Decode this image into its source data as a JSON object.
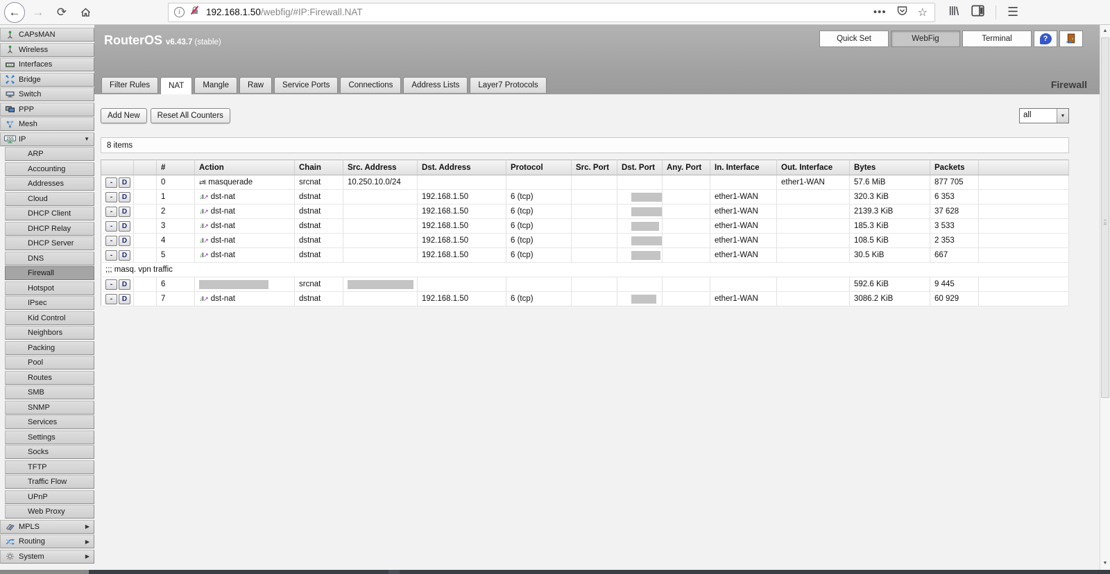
{
  "browser": {
    "url_host": "192.168.1.50",
    "url_path": "/webfig/#IP:Firewall.NAT"
  },
  "app_header": {
    "brand": "RouterOS",
    "version": "v6.43.7",
    "release": "(stable)",
    "nav_buttons": [
      {
        "label": "Quick Set",
        "active": false
      },
      {
        "label": "WebFig",
        "active": true
      },
      {
        "label": "Terminal",
        "active": false
      }
    ],
    "page_title": "Firewall"
  },
  "tabs": [
    {
      "label": "Filter Rules",
      "active": false
    },
    {
      "label": "NAT",
      "active": true
    },
    {
      "label": "Mangle",
      "active": false
    },
    {
      "label": "Raw",
      "active": false
    },
    {
      "label": "Service Ports",
      "active": false
    },
    {
      "label": "Connections",
      "active": false
    },
    {
      "label": "Address Lists",
      "active": false
    },
    {
      "label": "Layer7 Protocols",
      "active": false
    }
  ],
  "toolbar": {
    "add_new_label": "Add New",
    "reset_label": "Reset All Counters",
    "filter_value": "all"
  },
  "items_label": "8 items",
  "table": {
    "headers": [
      "#",
      "Action",
      "Chain",
      "Src. Address",
      "Dst. Address",
      "Protocol",
      "Src. Port",
      "Dst. Port",
      "Any. Port",
      "In. Interface",
      "Out. Interface",
      "Bytes",
      "Packets"
    ],
    "row_buttons": [
      "-",
      "D"
    ],
    "rows": [
      {
        "type": "rule",
        "num": "0",
        "action": "masquerade",
        "icon": "masquerade",
        "chain": "srcnat",
        "src_address": "10.250.10.0/24",
        "dst_address": "",
        "protocol": "",
        "src_port": "",
        "dst_port": "",
        "any_port": "",
        "in_interface": "",
        "out_interface": "ether1-WAN",
        "bytes": "57.6 MiB",
        "packets": "877 705",
        "redactions": {}
      },
      {
        "type": "rule",
        "num": "1",
        "action": "dst-nat",
        "icon": "dst-nat",
        "chain": "dstnat",
        "src_address": "",
        "dst_address": "192.168.1.50",
        "protocol": "6 (tcp)",
        "src_port": "",
        "dst_port": "",
        "any_port": "",
        "in_interface": "ether1-WAN",
        "out_interface": "",
        "bytes": "320.3 KiB",
        "packets": "6 353",
        "redactions": {
          "dst_port": 54
        }
      },
      {
        "type": "rule",
        "num": "2",
        "action": "dst-nat",
        "icon": "dst-nat",
        "chain": "dstnat",
        "src_address": "",
        "dst_address": "192.168.1.50",
        "protocol": "6 (tcp)",
        "src_port": "",
        "dst_port": "",
        "any_port": "",
        "in_interface": "ether1-WAN",
        "out_interface": "",
        "bytes": "2139.3 KiB",
        "packets": "37 628",
        "redactions": {
          "dst_port": 52
        }
      },
      {
        "type": "rule",
        "num": "3",
        "action": "dst-nat",
        "icon": "dst-nat",
        "chain": "dstnat",
        "src_address": "",
        "dst_address": "192.168.1.50",
        "protocol": "6 (tcp)",
        "src_port": "",
        "dst_port": "",
        "any_port": "",
        "in_interface": "ether1-WAN",
        "out_interface": "",
        "bytes": "185.3 KiB",
        "packets": "3 533",
        "redactions": {
          "dst_port": 40
        }
      },
      {
        "type": "rule",
        "num": "4",
        "action": "dst-nat",
        "icon": "dst-nat",
        "chain": "dstnat",
        "src_address": "",
        "dst_address": "192.168.1.50",
        "protocol": "6 (tcp)",
        "src_port": "",
        "dst_port": "",
        "any_port": "",
        "in_interface": "ether1-WAN",
        "out_interface": "",
        "bytes": "108.5 KiB",
        "packets": "2 353",
        "redactions": {
          "dst_port": 45
        }
      },
      {
        "type": "rule",
        "num": "5",
        "action": "dst-nat",
        "icon": "dst-nat",
        "chain": "dstnat",
        "src_address": "",
        "dst_address": "192.168.1.50",
        "protocol": "6 (tcp)",
        "src_port": "",
        "dst_port": "",
        "any_port": "",
        "in_interface": "ether1-WAN",
        "out_interface": "",
        "bytes": "30.5 KiB",
        "packets": "667",
        "redactions": {
          "dst_port": 42
        }
      },
      {
        "type": "comment",
        "text": ";;; masq. vpn traffic"
      },
      {
        "type": "rule",
        "num": "6",
        "action": "",
        "icon": null,
        "chain": "srcnat",
        "src_address": "",
        "dst_address": "",
        "protocol": "",
        "src_port": "",
        "dst_port": "",
        "any_port": "",
        "in_interface": "",
        "out_interface": "",
        "bytes": "592.6 KiB",
        "packets": "9 445",
        "redactions": {
          "action": 100,
          "src_address": 95
        }
      },
      {
        "type": "rule",
        "num": "7",
        "action": "dst-nat",
        "icon": "dst-nat",
        "chain": "dstnat",
        "src_address": "",
        "dst_address": "192.168.1.50",
        "protocol": "6 (tcp)",
        "src_port": "",
        "dst_port": "",
        "any_port": "",
        "in_interface": "ether1-WAN",
        "out_interface": "",
        "bytes": "3086.2 KiB",
        "packets": "60 929",
        "redactions": {
          "dst_port": 36
        }
      }
    ]
  },
  "sidebar": {
    "items": [
      {
        "label": "CAPsMAN",
        "icon": "antenna"
      },
      {
        "label": "Wireless",
        "icon": "antenna"
      },
      {
        "label": "Interfaces",
        "icon": "interfaces"
      },
      {
        "label": "Bridge",
        "icon": "bridge"
      },
      {
        "label": "Switch",
        "icon": "switch"
      },
      {
        "label": "PPP",
        "icon": "ppp"
      },
      {
        "label": "Mesh",
        "icon": "mesh"
      },
      {
        "label": "IP",
        "icon": "ip",
        "expanded": true
      },
      {
        "label": "ARP",
        "sub": true
      },
      {
        "label": "Accounting",
        "sub": true
      },
      {
        "label": "Addresses",
        "sub": true
      },
      {
        "label": "Cloud",
        "sub": true
      },
      {
        "label": "DHCP Client",
        "sub": true
      },
      {
        "label": "DHCP Relay",
        "sub": true
      },
      {
        "label": "DHCP Server",
        "sub": true
      },
      {
        "label": "DNS",
        "sub": true
      },
      {
        "label": "Firewall",
        "sub": true,
        "selected": true
      },
      {
        "label": "Hotspot",
        "sub": true
      },
      {
        "label": "IPsec",
        "sub": true
      },
      {
        "label": "Kid Control",
        "sub": true
      },
      {
        "label": "Neighbors",
        "sub": true
      },
      {
        "label": "Packing",
        "sub": true
      },
      {
        "label": "Pool",
        "sub": true
      },
      {
        "label": "Routes",
        "sub": true
      },
      {
        "label": "SMB",
        "sub": true
      },
      {
        "label": "SNMP",
        "sub": true
      },
      {
        "label": "Services",
        "sub": true
      },
      {
        "label": "Settings",
        "sub": true
      },
      {
        "label": "Socks",
        "sub": true
      },
      {
        "label": "TFTP",
        "sub": true
      },
      {
        "label": "Traffic Flow",
        "sub": true
      },
      {
        "label": "UPnP",
        "sub": true
      },
      {
        "label": "Web Proxy",
        "sub": true
      },
      {
        "label": "MPLS",
        "icon": "mpls",
        "collapsible": true
      },
      {
        "label": "Routing",
        "icon": "routing",
        "collapsible": true
      },
      {
        "label": "System",
        "icon": "system",
        "collapsible": true
      }
    ]
  }
}
